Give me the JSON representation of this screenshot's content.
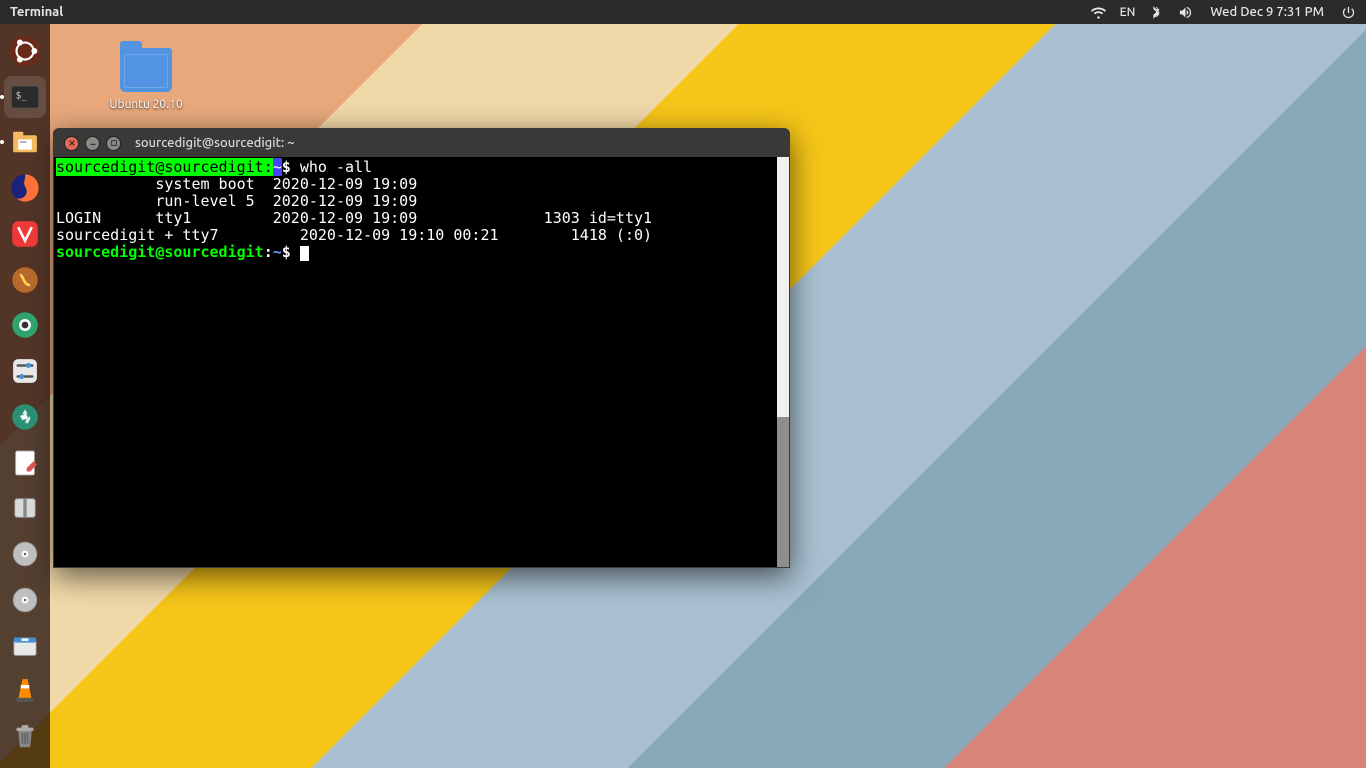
{
  "top_panel": {
    "active_app": "Terminal",
    "lang": "EN",
    "datetime": "Wed Dec  9  7:31 PM"
  },
  "desktop_icon": {
    "label": "Ubuntu 20.10"
  },
  "launcher": {
    "items": [
      {
        "name": "ubuntu-dash",
        "color": "#e95420"
      },
      {
        "name": "terminal",
        "color": "#2c2c2c",
        "running": true,
        "active": true
      },
      {
        "name": "files",
        "color": "#f4b860",
        "running": true
      },
      {
        "name": "firefox",
        "color": "#ff7139"
      },
      {
        "name": "vivaldi",
        "color": "#ef3939"
      },
      {
        "name": "synergy",
        "color": "#b86a2e"
      },
      {
        "name": "shutter",
        "color": "#2ea36d"
      },
      {
        "name": "gnome-tweaks",
        "color": "#d9d9d9"
      },
      {
        "name": "dconf",
        "color": "#2b8f74"
      },
      {
        "name": "gedit",
        "color": "#ffffff"
      },
      {
        "name": "archive",
        "color": "#d9d9d9"
      },
      {
        "name": "disks",
        "color": "#bfbfbf"
      },
      {
        "name": "disks2",
        "color": "#bfbfbf"
      },
      {
        "name": "software",
        "color": "#e0e0e0"
      },
      {
        "name": "vlc",
        "color": "#ff8a00"
      }
    ],
    "trash": {
      "name": "trash"
    }
  },
  "terminal": {
    "title": "sourcedigit@sourcedigit: ~",
    "prompt": {
      "user": "sourcedigit@sourcedigit",
      "path": "~",
      "symbol": "$"
    },
    "command": "who -all",
    "output_lines": [
      "           system boot  2020-12-09 19:09",
      "           run-level 5  2020-12-09 19:09",
      "LOGIN      tty1         2020-12-09 19:09              1303 id=tty1",
      "sourcedigit + tty7         2020-12-09 19:10 00:21        1418 (:0)"
    ]
  }
}
